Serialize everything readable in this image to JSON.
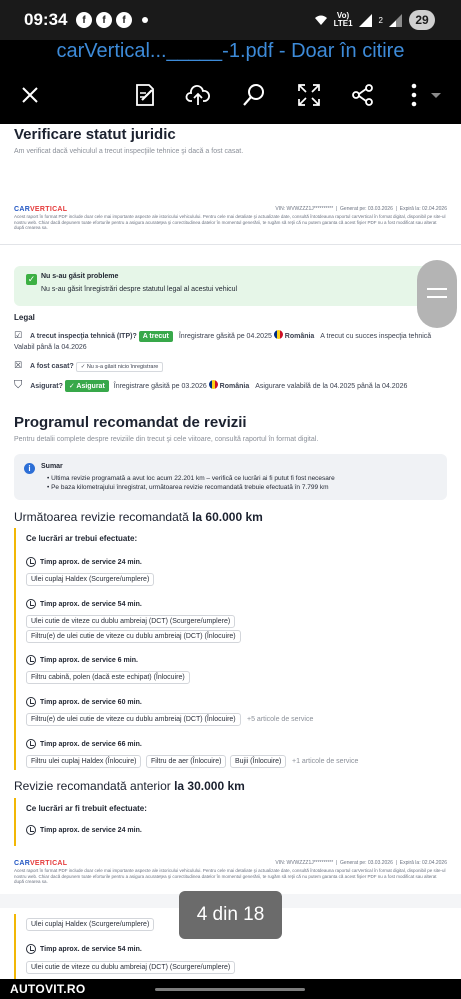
{
  "status_bar": {
    "time": "09:34",
    "apps": [
      "f",
      "f",
      "f"
    ],
    "net_top": "Vo)",
    "net_bottom": "LTE1",
    "sim": "2",
    "battery": "29"
  },
  "header": {
    "title": "carVertical..._____-1.pdf - Doar în citire",
    "icons": [
      "close-icon",
      "edit-icon",
      "cloud-upload-icon",
      "search-icon",
      "fullscreen-icon",
      "share-icon",
      "more-icon"
    ]
  },
  "page": {
    "legal_status": {
      "title": "Verificare statut juridic",
      "subtitle": "Am verificat dacă vehiculul a trecut inspecţiile tehnice şi dacă a fost casat."
    },
    "footer": {
      "logo_main": "CAR",
      "logo_accent": "VERTICAL",
      "vin": "VIN: WVWZZZ1J**********",
      "generated": "Generat pe: 03.03.2026",
      "expires": "Expiră la: 02.04.2026",
      "disclaimer": "Acest raport în format PDF include doar cele mai importante aspecte ale istoricului vehiculului. Pentru cele mai detaliate şi actualizate date, consultă întotdeauna raportul carVertical în format digital, disponibil pe site-ul nostru web. Chiar dacă depunem toate eforturile pentru a asigura acurateţea şi corectitudinea datelor în momentul generării, te rugăm să reţii că nu putem garanta că acest fişier PDF nu a fost modificat sau alterat după crearea sa."
    },
    "success": {
      "title": "Nu s-au găsit probleme",
      "text": "Nu s-au găsit înregistrări despre statutul legal al acestui vehicul"
    },
    "legal": {
      "heading": "Legal",
      "itp_label": "A trecut inspecţia tehnică (ITP)?",
      "itp_chip": "A trecut",
      "itp_record": "Înregistrare găsită pe 04.2025",
      "itp_country": "România",
      "itp_note": "A trecut cu succes inspecţia tehnică",
      "itp_valid": "Valabil până la 04.2026",
      "scrap_label": "A fost casat?",
      "scrap_chip": "Nu s-a găsit nicio înregistrare",
      "ins_label": "Asigurat?",
      "ins_chip": "Asigurat",
      "ins_record": "Înregistrare găsită pe 03.2026",
      "ins_country": "România",
      "ins_note": "Asigurare valabilă de la 04.2025 până la 04.2026"
    },
    "service": {
      "title": "Programul recomandat de revizii",
      "subtitle": "Pentru detalii complete despre reviziile din trecut şi cele viitoare, consultă raportul în format digital.",
      "summary_title": "Sumar",
      "summary_1": "Ultima revizie programată a avut loc acum 22.201 km – verifică ce lucrări ai fi putut fi fost necesare",
      "summary_2": "Pe baza kilometrajului înregistrat, următoarea revizie recomandată trebuie efectuată în 7.799 km",
      "next_label": "Următoarea revizie recomandată",
      "next_km": "la 60.000 km",
      "work_title": "Ce lucrări ar trebui efectuate:",
      "time_24": "Timp aprox. de service 24 min.",
      "item_haldex": "Ulei cuplaj Haldex (Scurgere/umplere)",
      "time_54": "Timp aprox. de service 54 min.",
      "item_dct_oil": "Ulei cutie de viteze cu dublu ambreiaj (DCT) (Scurgere/umplere)",
      "item_dct_filter": "Filtru(e) de ulei cutie de viteze cu dublu ambreiaj (DCT) (Înlocuire)",
      "time_6": "Timp aprox. de service 6 min.",
      "item_cabin": "Filtru cabină, polen (dacă este echipat) (Înlocuire)",
      "time_60": "Timp aprox. de service 60 min.",
      "more_5": "+5 articole de service",
      "time_66": "Timp aprox. de service 66 min.",
      "item_haldex_filter": "Filtru ulei cuplaj Haldex (Înlocuire)",
      "item_air": "Filtru de aer (Înlocuire)",
      "item_plugs": "Bujii (Înlocuire)",
      "more_1": "+1 articole de service",
      "prev_label": "Revizie recomandată anterior",
      "prev_km": "la 30.000 km",
      "prev_work_title": "Ce lucrări ar fi trebuit efectuate:"
    },
    "page_indicator": "4 din 18"
  },
  "watermark": "AUTOVIT.RO"
}
